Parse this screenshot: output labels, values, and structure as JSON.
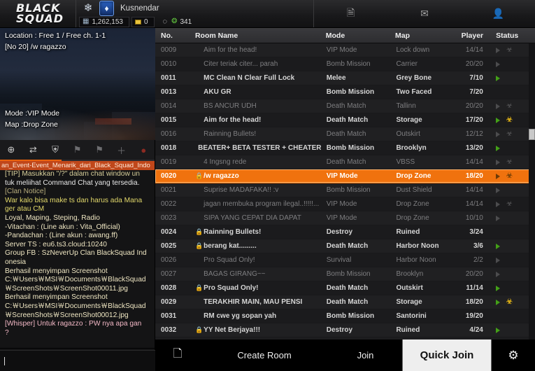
{
  "header": {
    "logo_line1": "BLACK",
    "logo_line2": "SQUAD",
    "rank_icon": "rank-insignia-icon",
    "clan_badge_icon": "clan-shield-icon",
    "username": "Kusnendar",
    "currency": {
      "gp_icon": "gp-icon",
      "gp_value": "1,262,153",
      "coin_icon": "coin-icon",
      "coin_value": "0",
      "refresh_icon": "refresh-icon",
      "cash_icon": "cash-icon",
      "cash_value": "341"
    },
    "nav": [
      {
        "name": "notes-icon",
        "glyph": "὜E"
      },
      {
        "name": "mail-icon",
        "glyph": "✉"
      },
      {
        "name": "profile-icon",
        "glyph": "὆4"
      }
    ]
  },
  "preview": {
    "location_label": "Location : Free 1 / Free ch. 1-1",
    "room_label": "[No 20]  /w ragazzo",
    "mode_label": "Mode :VIP Mode",
    "map_label": "Map :Drop Zone"
  },
  "chat_tabs": [
    {
      "name": "tab-global",
      "glyph": "⊕"
    },
    {
      "name": "tab-switch",
      "glyph": "⇄"
    },
    {
      "name": "tab-clan",
      "glyph": "⛨"
    },
    {
      "name": "tab-channel-a",
      "glyph": "⚑"
    },
    {
      "name": "tab-channel-b",
      "glyph": "⚑"
    },
    {
      "name": "tab-add",
      "glyph": "＋"
    },
    {
      "name": "tab-mute",
      "glyph": "●"
    }
  ],
  "chat": {
    "notice_bar": "an_Event-Event_Menarik_dari_Black_Squad_Indo",
    "messages": [
      {
        "text": "[TIP] Masukkan \"/?\" dalam chat window un",
        "cls": "c-tip"
      },
      {
        "text": "tuk meliihat Command Chat yang tersedia.",
        "cls": "c-white"
      },
      {
        "text": "[Clan Notice]",
        "cls": "c-notice"
      },
      {
        "text": "War kalo bisa make ts dan harus ada Mana",
        "cls": "c-yellow"
      },
      {
        "text": "ger atau CM",
        "cls": "c-yellow"
      },
      {
        "text": "Loyal, Maping, Steping, Radio",
        "cls": "c-cream"
      },
      {
        "text": "-Vitachan     : (Line akun : Vita_Official)",
        "cls": "c-cream"
      },
      {
        "text": "-Pandachan : (Line akun : awang.ff)",
        "cls": "c-cream"
      },
      {
        "text": "Server TS : eu6.ts3.cloud:10240",
        "cls": "c-cream"
      },
      {
        "text": "Group FB  : SzNeverUp Clan BlackSquad Ind",
        "cls": "c-cream"
      },
      {
        "text": "onesia",
        "cls": "c-cream"
      },
      {
        "text": "Berhasil menyimpan Screenshot",
        "cls": "c-cream"
      },
      {
        "text": "C:￦Users￦MSI￦Documents￦BlackSquad",
        "cls": "c-cream"
      },
      {
        "text": "￦ScreenShots￦ScreenShot00011.jpg",
        "cls": "c-cream"
      },
      {
        "text": "Berhasil menyimpan Screenshot",
        "cls": "c-cream"
      },
      {
        "text": "C:￦Users￦MSI￦Documents￦BlackSquad",
        "cls": "c-cream"
      },
      {
        "text": "￦ScreenShots￦ScreenShot00012.jpg",
        "cls": "c-cream"
      },
      {
        "text": "[Whisper] Untuk ragazzo  : PW nya apa gan",
        "cls": "c-whisper"
      },
      {
        "text": "?",
        "cls": "c-whisper"
      }
    ],
    "input_value": "",
    "input_placeholder": ""
  },
  "room_list": {
    "columns": [
      "No.",
      "Room Name",
      "Mode",
      "Map",
      "Player",
      "Status"
    ],
    "rows": [
      {
        "no": "0009",
        "name": "Aim for the head!",
        "locked": false,
        "mode": "VIP Mode",
        "map": "Lock down",
        "player": "14/14",
        "play": "dim",
        "skull": "dim",
        "active": false
      },
      {
        "no": "0010",
        "name": "Citer teriak citer... parah",
        "locked": false,
        "mode": "Bomb Mission",
        "map": "Carrier",
        "player": "20/20",
        "play": "dim",
        "skull": "none",
        "active": false
      },
      {
        "no": "0011",
        "name": "MC Clean N Clear Full Lock",
        "locked": false,
        "mode": "Melee",
        "map": "Grey Bone",
        "player": "7/10",
        "play": "on",
        "skull": "none",
        "active": true
      },
      {
        "no": "0013",
        "name": "AKU GR",
        "locked": false,
        "mode": "Bomb Mission",
        "map": "Two Faced",
        "player": "7/20",
        "play": "none",
        "skull": "none",
        "active": true
      },
      {
        "no": "0014",
        "name": "BS ANCUR UDH",
        "locked": false,
        "mode": "Death Match",
        "map": "Tallinn",
        "player": "20/20",
        "play": "dim",
        "skull": "dim",
        "active": false
      },
      {
        "no": "0015",
        "name": "Aim for the head!",
        "locked": false,
        "mode": "Death Match",
        "map": "Storage",
        "player": "17/20",
        "play": "on",
        "skull": "gold",
        "active": true
      },
      {
        "no": "0016",
        "name": "Rainning Bullets!",
        "locked": false,
        "mode": "Death Match",
        "map": "Outskirt",
        "player": "12/12",
        "play": "dim",
        "skull": "dim",
        "active": false
      },
      {
        "no": "0018",
        "name": "BEATER+ BETA TESTER + CHEATER",
        "locked": false,
        "mode": "Bomb Mission",
        "map": "Brooklyn",
        "player": "13/20",
        "play": "on",
        "skull": "none",
        "active": true
      },
      {
        "no": "0019",
        "name": "4 Ingsng rede",
        "locked": false,
        "mode": "Death Match",
        "map": "VBSS",
        "player": "14/14",
        "play": "dim",
        "skull": "dim",
        "active": false
      },
      {
        "no": "0020",
        "name": "/w ragazzo",
        "locked": true,
        "mode": "VIP Mode",
        "map": "Drop Zone",
        "player": "18/20",
        "play": "sel",
        "skull": "sel",
        "active": true,
        "selected": true
      },
      {
        "no": "0021",
        "name": "Suprise MADAFAKA!! :v",
        "locked": false,
        "mode": "Bomb Mission",
        "map": "Dust Shield",
        "player": "14/14",
        "play": "dim",
        "skull": "none",
        "active": false
      },
      {
        "no": "0022",
        "name": "jagan membuka program ilegal..!!!!!...",
        "locked": false,
        "mode": "VIP Mode",
        "map": "Drop Zone",
        "player": "14/14",
        "play": "dim",
        "skull": "dim",
        "active": false
      },
      {
        "no": "0023",
        "name": "SIPA YANG CEPAT DIA DAPAT",
        "locked": false,
        "mode": "VIP Mode",
        "map": "Drop Zone",
        "player": "10/10",
        "play": "dim",
        "skull": "none",
        "active": false
      },
      {
        "no": "0024",
        "name": "Rainning Bullets!",
        "locked": true,
        "mode": "Destroy",
        "map": "Ruined",
        "player": "3/24",
        "play": "none",
        "skull": "none",
        "active": true
      },
      {
        "no": "0025",
        "name": "berang kat.........",
        "locked": true,
        "mode": "Death Match",
        "map": "Harbor Noon",
        "player": "3/6",
        "play": "on",
        "skull": "none",
        "active": true
      },
      {
        "no": "0026",
        "name": "Pro Squad Only!",
        "locked": false,
        "mode": "Survival",
        "map": "Harbor Noon",
        "player": "2/2",
        "play": "dim",
        "skull": "none",
        "active": false
      },
      {
        "no": "0027",
        "name": "BAGAS GIRANG~~",
        "locked": false,
        "mode": "Bomb Mission",
        "map": "Brooklyn",
        "player": "20/20",
        "play": "dim",
        "skull": "none",
        "active": false
      },
      {
        "no": "0028",
        "name": "Pro Squad Only!",
        "locked": true,
        "mode": "Death Match",
        "map": "Outskirt",
        "player": "11/14",
        "play": "on",
        "skull": "none",
        "active": true
      },
      {
        "no": "0029",
        "name": "TERAKHIR MAIN, MAU PENSI",
        "locked": false,
        "mode": "Death Match",
        "map": "Storage",
        "player": "18/20",
        "play": "on",
        "skull": "gold",
        "active": true
      },
      {
        "no": "0031",
        "name": "RM cwe yg sopan yah",
        "locked": false,
        "mode": "Bomb Mission",
        "map": "Santorini",
        "player": "19/20",
        "play": "none",
        "skull": "none",
        "active": true
      },
      {
        "no": "0032",
        "name": "YY Net Berjaya!!!",
        "locked": true,
        "mode": "Destroy",
        "map": "Ruined",
        "player": "4/24",
        "play": "on",
        "skull": "none",
        "active": true
      }
    ]
  },
  "bottom_bar": {
    "roster_icon": "roster-icon",
    "create_room_label": "Create Room",
    "join_label": "Join",
    "quick_join_label": "Quick Join",
    "settings_icon": "gear-icon"
  },
  "colors": {
    "accent_orange": "#f0720e",
    "green_play": "#43a017",
    "gold_skull": "#e0b215"
  }
}
